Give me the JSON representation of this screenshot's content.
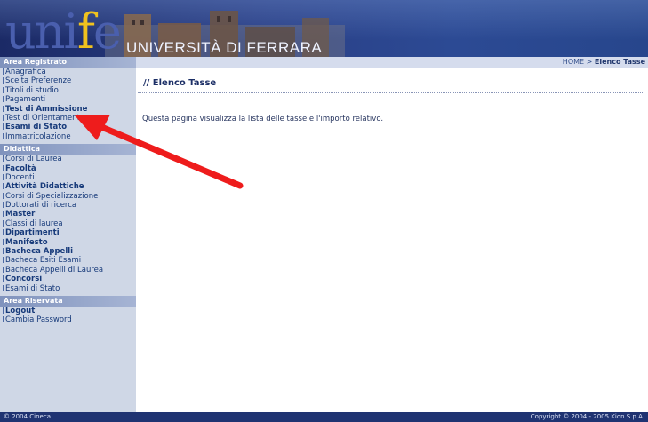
{
  "header": {
    "logo_prefix": "uni",
    "logo_letter": "f",
    "logo_suffix": "e",
    "university": "UNIVERSITÀ DI FERRARA"
  },
  "breadcrumb": {
    "home": "HOME",
    "sep": ">",
    "current": "Elenco Tasse"
  },
  "sidebar": {
    "sections": [
      {
        "title": "Area Registrato",
        "items": [
          "Anagrafica",
          "Scelta Preferenze",
          "Titoli di studio",
          "Pagamenti",
          "Test di Ammissione",
          "Test di Orientamento",
          "Esami di Stato",
          "Immatricolazione"
        ]
      },
      {
        "title": "Didattica",
        "items": [
          "Corsi di Laurea",
          "Facoltà",
          "Docenti",
          "Attività Didattiche",
          "Corsi di Specializzazione",
          "Dottorati di ricerca",
          "Master",
          "Classi di laurea",
          "Dipartimenti",
          "Manifesto",
          "Bacheca Appelli",
          "Bacheca Esiti Esami",
          "Bacheca Appelli di Laurea",
          "Concorsi",
          "Esami di Stato"
        ]
      },
      {
        "title": "Area Riservata",
        "items": [
          "Logout",
          "Cambia Password"
        ]
      }
    ]
  },
  "main": {
    "title": "// Elenco Tasse",
    "description": "Questa pagina visualizza la lista delle tasse e l'importo relativo."
  },
  "footer": {
    "left": "© 2004 Cineca",
    "right": "Copyright © 2004 - 2005 Kion S.p.A."
  },
  "annotation": {
    "arrow_color": "#ee1c1c"
  }
}
